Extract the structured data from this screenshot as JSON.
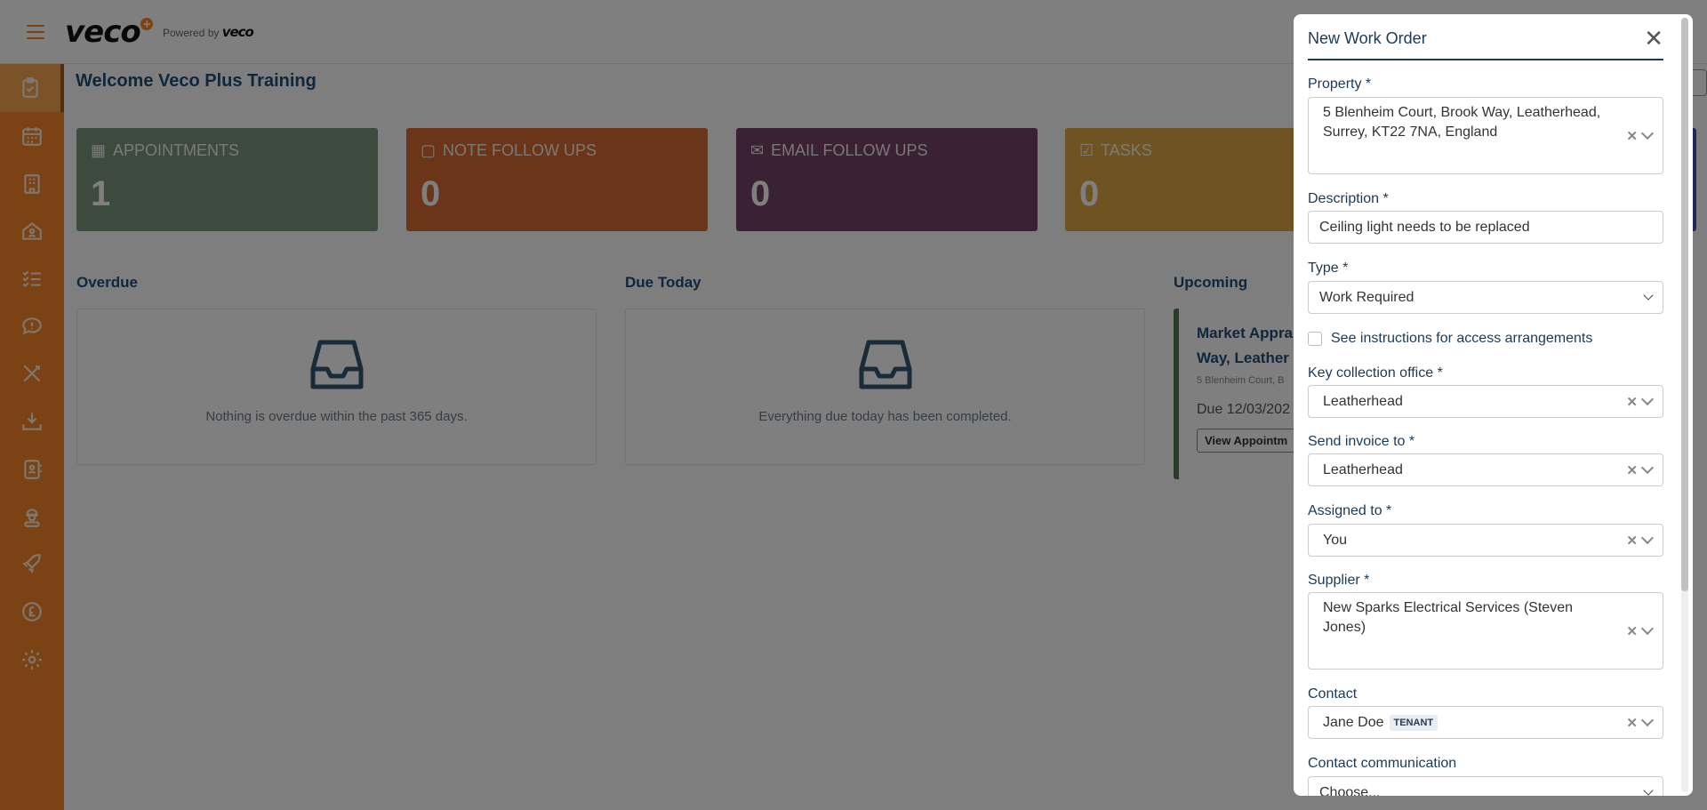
{
  "topbar": {
    "logo": "veco",
    "powered_by": "Powered by",
    "powered_logo": "veco"
  },
  "sidebar": {
    "items": [
      "tasks-clipboard",
      "calendar",
      "building",
      "home-user",
      "checklist",
      "chat-alert",
      "tools",
      "download-tray",
      "contact-book",
      "worker",
      "rocket",
      "pound",
      "settings"
    ]
  },
  "welcome": "Welcome Veco Plus Training",
  "cards": [
    {
      "title": "APPOINTMENTS",
      "count": "1",
      "color": "#7b947c",
      "icon": "calendar-icon"
    },
    {
      "title": "NOTE FOLLOW UPS",
      "count": "0",
      "color": "#d46a32",
      "icon": "note-icon"
    },
    {
      "title": "EMAIL FOLLOW UPS",
      "count": "0",
      "color": "#744468",
      "icon": "envelope-icon"
    },
    {
      "title": "TASKS",
      "count": "0",
      "color": "#dea640",
      "icon": "check-square-icon"
    }
  ],
  "sections": {
    "overdue": {
      "title": "Overdue",
      "empty": "Nothing is overdue within the past 365 days."
    },
    "due_today": {
      "title": "Due Today",
      "empty": "Everything due today has been completed."
    },
    "upcoming": {
      "title": "Upcoming",
      "item_title_1": "Market Appra",
      "item_title_2": "Way, Leather",
      "address": "5 Blenheim Court, B",
      "due": "Due 12/03/202",
      "button": "View Appointm"
    }
  },
  "modal": {
    "title": "New Work Order",
    "property_label": "Property *",
    "property_value": "5 Blenheim Court, Brook Way, Leatherhead, Surrey, KT22 7NA, England",
    "description_label": "Description *",
    "description_value": "Ceiling light needs to be replaced",
    "type_label": "Type *",
    "type_value": "Work Required",
    "access_label": "See instructions for access arrangements",
    "key_label": "Key collection office *",
    "key_value": "Leatherhead",
    "invoice_label": "Send invoice to *",
    "invoice_value": "Leatherhead",
    "assigned_label": "Assigned to *",
    "assigned_value": "You",
    "supplier_label": "Supplier *",
    "supplier_value": "New Sparks Electrical Services (Steven Jones)",
    "contact_label": "Contact",
    "contact_value": "Jane Doe",
    "contact_tag": "TENANT",
    "comm_label": "Contact communication",
    "comm_value": "Choose..."
  }
}
